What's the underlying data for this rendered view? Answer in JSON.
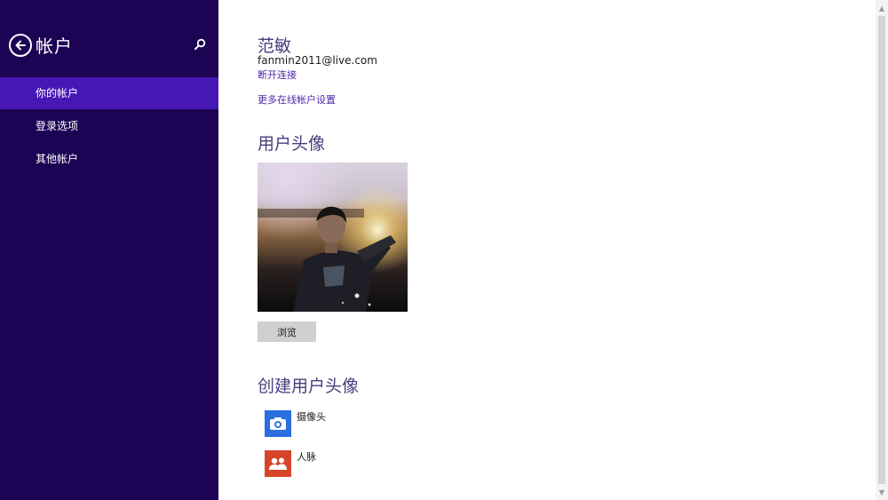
{
  "sidebar": {
    "title": "帐户",
    "items": [
      {
        "label": "你的帐户",
        "active": true
      },
      {
        "label": "登录选项",
        "active": false
      },
      {
        "label": "其他帐户",
        "active": false
      }
    ]
  },
  "account": {
    "name": "范敏",
    "email": "fanmin2011@live.com",
    "disconnect_label": "断开连接",
    "more_settings_label": "更多在线帐户设置"
  },
  "avatar_section": {
    "title": "用户头像",
    "browse_label": "浏览"
  },
  "create_section": {
    "title": "创建用户头像",
    "apps": [
      {
        "label": "摄像头",
        "icon": "camera-icon",
        "color": "#2b6ee0"
      },
      {
        "label": "人脉",
        "icon": "people-icon",
        "color": "#d6452a"
      }
    ]
  },
  "colors": {
    "sidebar_bg": "#1c0354",
    "active_item": "#4617b4",
    "accent_text": "#4a2aa5"
  }
}
